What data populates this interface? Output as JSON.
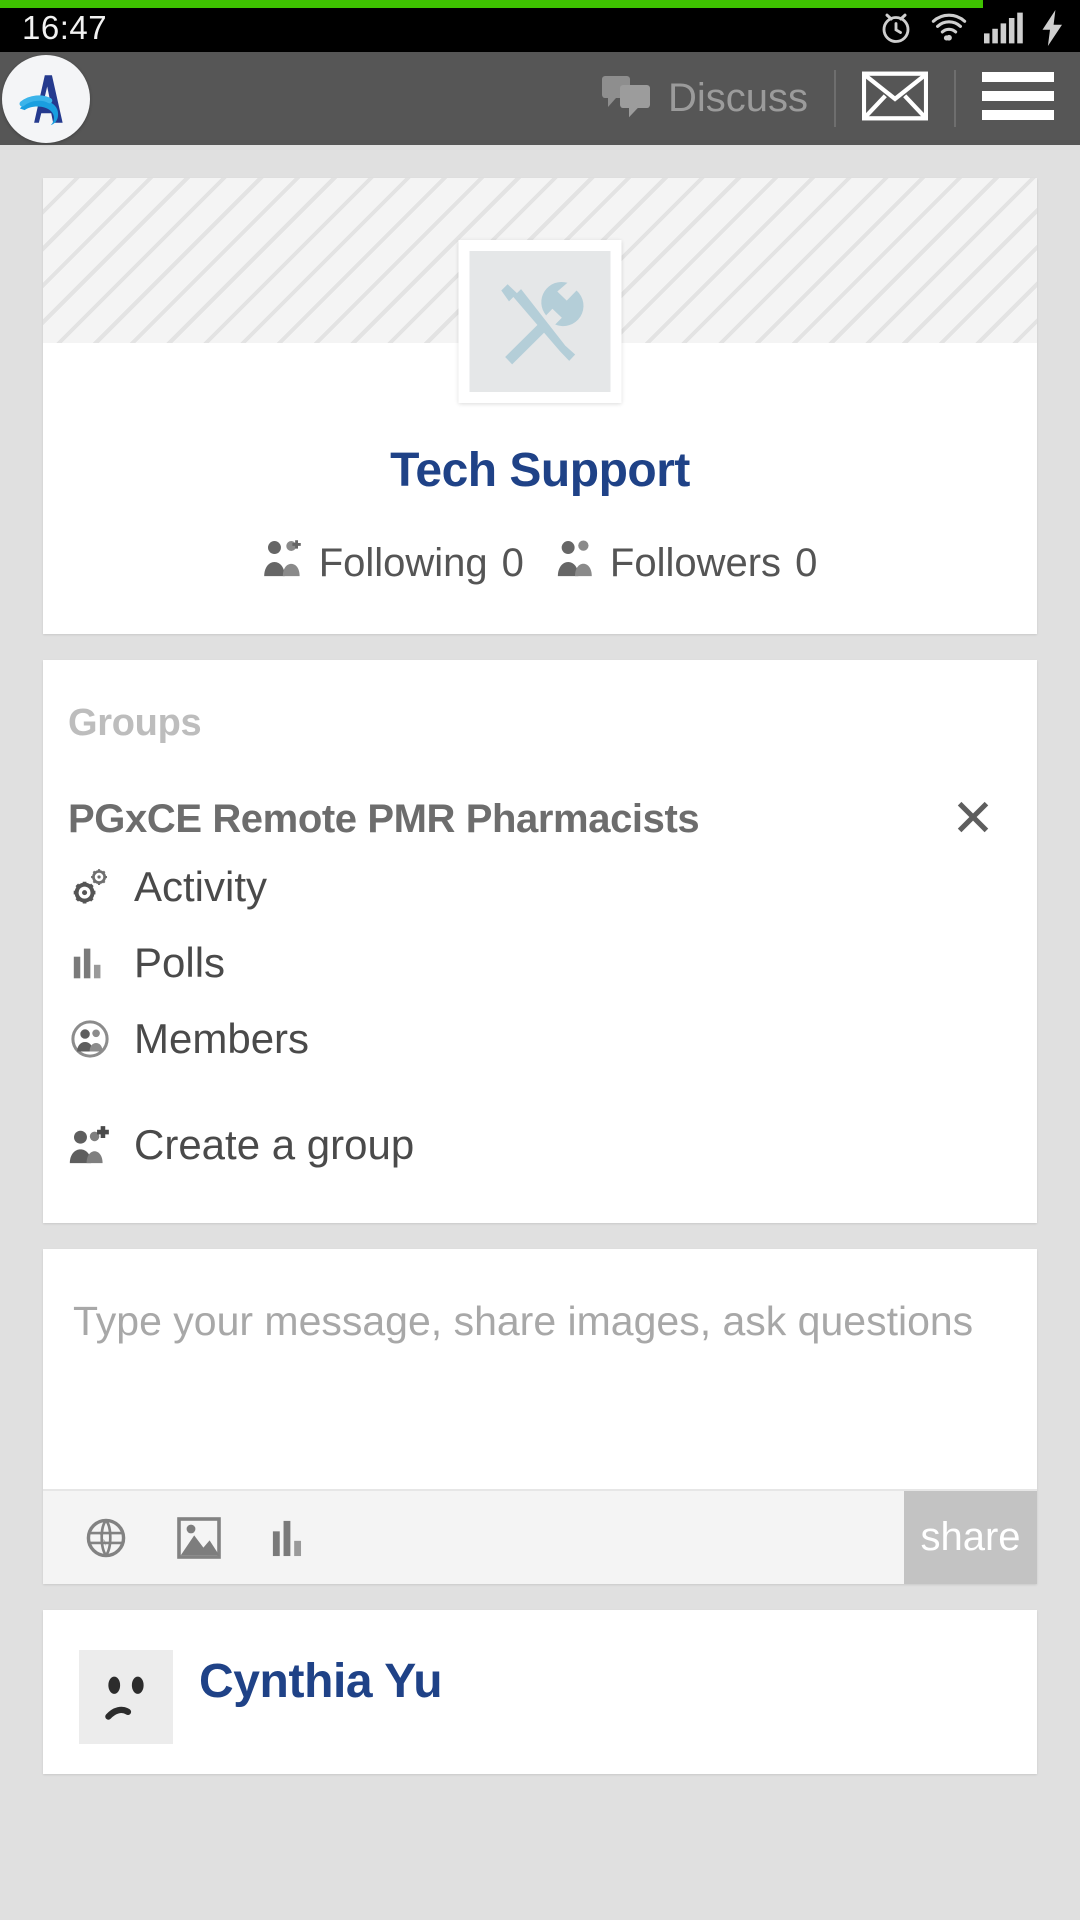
{
  "progress": {
    "percent": 91
  },
  "status_bar": {
    "clock": "16:47",
    "icons": [
      "alarm-icon",
      "wifi-icon",
      "signal-icon",
      "battery-charging-icon"
    ]
  },
  "app_bar": {
    "logo_icon": "app-logo-a-icon",
    "discuss_label": "Discuss",
    "discuss_icon": "chat-bubbles-icon",
    "messages_icon": "envelope-icon",
    "menu_icon": "hamburger-menu-icon"
  },
  "profile": {
    "avatar_icon": "tools-wrench-screwdriver-icon",
    "name": "Tech Support",
    "stats": [
      {
        "icon": "following-people-icon",
        "label": "Following",
        "value": "0"
      },
      {
        "icon": "followers-people-icon",
        "label": "Followers",
        "value": "0"
      }
    ]
  },
  "groups": {
    "heading": "Groups",
    "current_group": "PGxCE Remote PMR Pharmacists",
    "close_icon": "close-x-icon",
    "close_glyph": "✕",
    "items": [
      {
        "icon": "cogs-activity-icon",
        "label": "Activity"
      },
      {
        "icon": "bar-chart-polls-icon",
        "label": "Polls"
      },
      {
        "icon": "members-group-circle-icon",
        "label": "Members"
      }
    ],
    "create": {
      "icon": "user-plus-icon",
      "label": "Create a group"
    }
  },
  "composer": {
    "placeholder": "Type your message, share images, ask questions",
    "value": "",
    "tools": [
      {
        "icon": "globe-privacy-icon"
      },
      {
        "icon": "image-attach-icon"
      },
      {
        "icon": "poll-bar-chart-icon"
      }
    ],
    "share_label": "share"
  },
  "feed": {
    "posts": [
      {
        "author": "Cynthia Yu",
        "avatar_icon": "user-photo-avatar"
      }
    ]
  },
  "colors": {
    "accent_navy": "#1f4287",
    "progress_green": "#3ec200",
    "app_bar_gray": "#565656",
    "page_gray": "#e0e0e0",
    "share_gray": "#c3c3c3",
    "avatar_tool_blue": "#b4ced8"
  }
}
